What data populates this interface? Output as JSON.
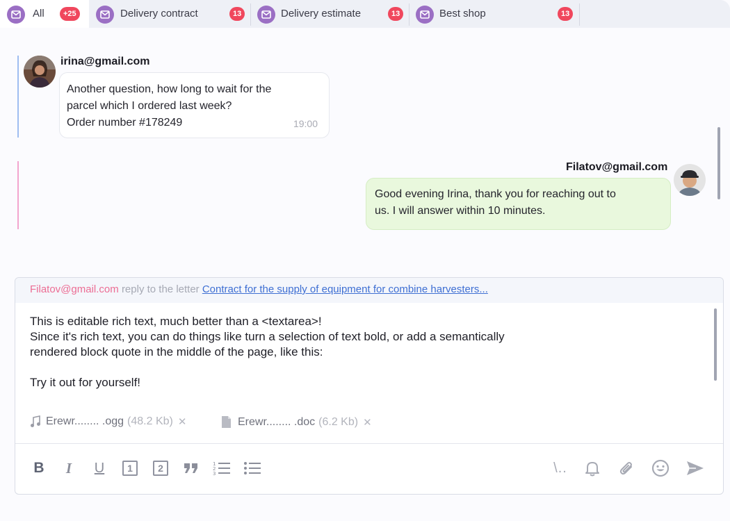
{
  "tabs": [
    {
      "label": "All",
      "badge": "+25"
    },
    {
      "label": "Delivery contract",
      "badge": "13"
    },
    {
      "label": "Delivery estimate",
      "badge": "13"
    },
    {
      "label": "Best shop",
      "badge": "13"
    }
  ],
  "messages": [
    {
      "sender": "irina@gmail.com",
      "lines": [
        "Another question, how long to wait for the",
        "parcel which I ordered last week?",
        "Order number #178249"
      ],
      "time": "19:00"
    },
    {
      "sender": "Filatov@gmail.com",
      "lines": [
        "Good evening Irina, thank you for reaching out to",
        "us. I will answer within 10 minutes."
      ]
    }
  ],
  "composer": {
    "reply_email": "Filatov@gmail.com",
    "reply_text": "reply to the letter",
    "reply_link": "Contract for the supply of equipment for combine harvesters...",
    "editor_lines": [
      "This is editable rich text, much better than a <textarea>!",
      "Since it's rich text, you can do things like turn a selection of text bold, or add a semantically",
      "rendered block quote in the middle of the page, like this:",
      "",
      "Try it out for yourself!"
    ],
    "attachments": [
      {
        "name": "Erewr........ .ogg",
        "size": "(48.2 Kb)",
        "icon": "music-note-icon"
      },
      {
        "name": "Erewr........ .doc",
        "size": "(6.2 Kb)",
        "icon": "document-icon"
      }
    ],
    "toolbar": {
      "bold": "B",
      "italic": "I",
      "underline": "U",
      "heading1": "1",
      "heading2": "2",
      "slash": "\\.."
    }
  },
  "colors": {
    "tab_icon": "#9b6fc4",
    "badge": "#f0475d",
    "outgoing_bubble": "#e9f8dd",
    "link": "#3e6fd3",
    "reply_email": "#ec6d94"
  }
}
